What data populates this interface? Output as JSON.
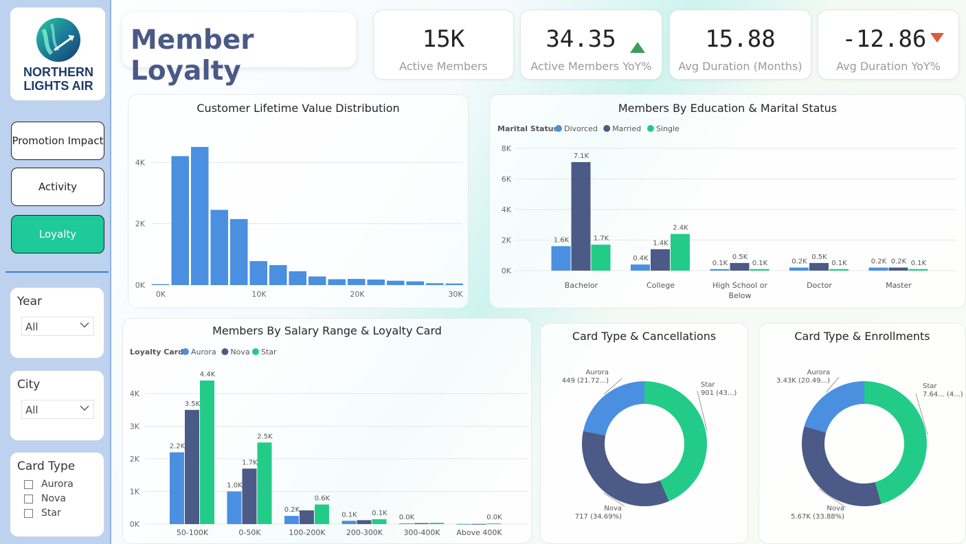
{
  "sidebar": {
    "logo": {
      "line1": "NORTHERN",
      "line2": "LIGHTS AIR"
    },
    "nav": [
      {
        "label": "Promotion Impact",
        "active": false
      },
      {
        "label": "Activity",
        "active": false
      },
      {
        "label": "Loyalty",
        "active": true
      }
    ],
    "slicers": {
      "year": {
        "title": "Year",
        "value": "All"
      },
      "city": {
        "title": "City",
        "value": "All"
      },
      "card_type": {
        "title": "Card Type",
        "options": [
          "Aurora",
          "Nova",
          "Star"
        ]
      }
    }
  },
  "page_title": "Member Loyalty",
  "kpis": [
    {
      "value": "15K",
      "label": "Active Members",
      "trend": "none"
    },
    {
      "value": "34.35",
      "label": "Active Members YoY%",
      "trend": "up"
    },
    {
      "value": "15.88",
      "label": "Avg Duration (Months)",
      "trend": "none"
    },
    {
      "value": "-12.86",
      "label": "Avg Duration YoY%",
      "trend": "down"
    }
  ],
  "colors": {
    "aurora": "#4a8fe0",
    "nova": "#4b5a86",
    "star": "#22cc88",
    "up": "#3d9d5b",
    "down": "#e05a3a"
  },
  "chart_data": [
    {
      "type": "bar",
      "title": "Customer Lifetime Value Distribution",
      "x": [
        0,
        1000,
        3000,
        5000,
        7000,
        9000,
        11000,
        13000,
        15000,
        17000,
        19000,
        21000,
        23000,
        25000,
        27000,
        29000,
        31000
      ],
      "values": [
        30,
        4200,
        4500,
        2450,
        2150,
        780,
        650,
        450,
        280,
        190,
        200,
        180,
        140,
        120,
        60,
        50
      ],
      "x_ticks": [
        "0K",
        "10K",
        "20K",
        "30K"
      ],
      "y_ticks": [
        "0K",
        "2K",
        "4K"
      ],
      "ylim": [
        0,
        4700
      ],
      "grid": true
    },
    {
      "type": "bar",
      "title": "Members By Education & Marital Status",
      "legend_title": "Marital Status",
      "categories": [
        "Bachelor",
        "College",
        "High School or Below",
        "Doctor",
        "Master"
      ],
      "series": [
        {
          "name": "Divorced",
          "values": [
            1600,
            400,
            100,
            200,
            200
          ],
          "labels": [
            "1.6K",
            "0.4K",
            "0.1K",
            "0.2K",
            "0.2K"
          ]
        },
        {
          "name": "Married",
          "values": [
            7100,
            1400,
            500,
            500,
            200
          ],
          "labels": [
            "7.1K",
            "1.4K",
            "0.5K",
            "0.5K",
            "0.2K"
          ]
        },
        {
          "name": "Single",
          "values": [
            1700,
            2400,
            100,
            100,
            100
          ],
          "labels": [
            "1.7K",
            "2.4K",
            "0.1K",
            "0.1K",
            "0.1K"
          ]
        }
      ],
      "y_ticks": [
        "0K",
        "2K",
        "4K",
        "6K",
        "8K"
      ],
      "ylim": [
        0,
        8000
      ],
      "legend": "top-left",
      "grid": true
    },
    {
      "type": "bar",
      "title": "Members By Salary Range & Loyalty Card",
      "legend_title": "Loyalty Card",
      "categories": [
        "50-100K",
        "0-50K",
        "100-200K",
        "200-300K",
        "300-400K",
        "Above 400K"
      ],
      "series": [
        {
          "name": "Aurora",
          "values": [
            2200,
            1000,
            250,
            100,
            20,
            5
          ],
          "labels": [
            "2.2K",
            "1.0K",
            "0.2K",
            "0.1K",
            "0.0K",
            ""
          ]
        },
        {
          "name": "Nova",
          "values": [
            3500,
            1700,
            420,
            120,
            30,
            5
          ],
          "labels": [
            "3.5K",
            "1.7K",
            "",
            "",
            "",
            ""
          ]
        },
        {
          "name": "Star",
          "values": [
            4400,
            2500,
            600,
            150,
            40,
            20
          ],
          "labels": [
            "4.4K",
            "2.5K",
            "0.6K",
            "0.1K",
            "",
            "0.0K"
          ]
        }
      ],
      "y_ticks": [
        "0K",
        "1K",
        "2K",
        "3K",
        "4K"
      ],
      "ylim": [
        0,
        4800
      ],
      "legend": "top-left",
      "grid": true
    },
    {
      "type": "pie",
      "title": "Card Type & Cancellations",
      "slices": [
        {
          "name": "Star",
          "value": 901,
          "label": "901 (43...)"
        },
        {
          "name": "Nova",
          "value": 717,
          "label": "717 (34.69%)"
        },
        {
          "name": "Aurora",
          "value": 449,
          "label": "449 (21.72...)"
        }
      ]
    },
    {
      "type": "pie",
      "title": "Card Type & Enrollments",
      "slices": [
        {
          "name": "Star",
          "value": 7640,
          "label": "7.64... (4...)"
        },
        {
          "name": "Nova",
          "value": 5670,
          "label": "5.67K (33.88%)"
        },
        {
          "name": "Aurora",
          "value": 3430,
          "label": "3.43K (20.49...)"
        }
      ]
    }
  ]
}
